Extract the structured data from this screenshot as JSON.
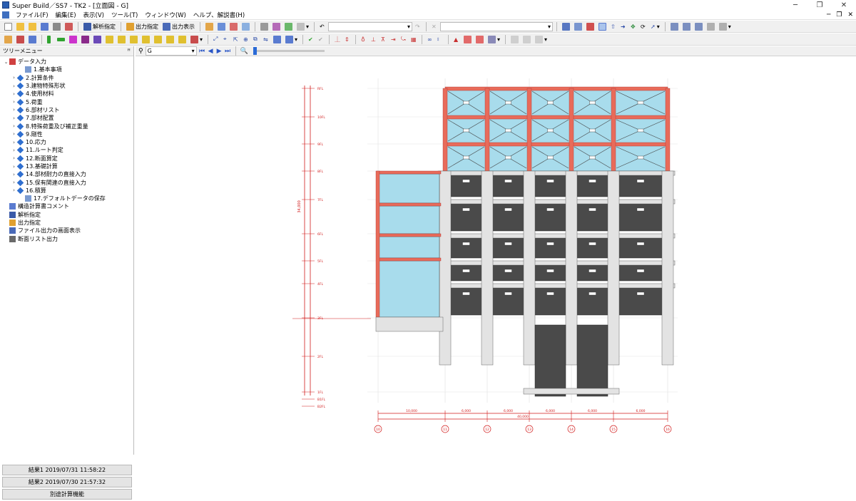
{
  "window": {
    "title": "Super Build／SS7 - TK2 - [立面図 - G]"
  },
  "menu": [
    "ファイル(F)",
    "編集(E)",
    "表示(V)",
    "ツール(T)",
    "ウィンドウ(W)",
    "ヘルプ、解説書(H)"
  ],
  "toolbar": {
    "analysis_label": "解析指定",
    "output_label": "出力指定",
    "display_label": "出力表示"
  },
  "nav": {
    "frame_value": "G"
  },
  "panel": {
    "title": "ツリーメニュー",
    "pin": "ꟸ"
  },
  "tree": [
    {
      "label": "データ入力",
      "depth": 0,
      "expanded": true,
      "icon": "data-input-icon"
    },
    {
      "label": "1.基本事項",
      "depth": 2,
      "expanded": null,
      "icon": "sheet-icon"
    },
    {
      "label": "2.計算条件",
      "depth": 1,
      "expanded": false,
      "icon": "diamond-icon"
    },
    {
      "label": "3.建物特殊形状",
      "depth": 1,
      "expanded": false,
      "icon": "diamond-icon"
    },
    {
      "label": "4.使用材料",
      "depth": 1,
      "expanded": false,
      "icon": "diamond-icon"
    },
    {
      "label": "5.荷重",
      "depth": 1,
      "expanded": false,
      "icon": "diamond-icon"
    },
    {
      "label": "6.部材リスト",
      "depth": 1,
      "expanded": false,
      "icon": "diamond-icon"
    },
    {
      "label": "7.部材配置",
      "depth": 1,
      "expanded": false,
      "icon": "diamond-icon"
    },
    {
      "label": "8.特殊荷重及び補正重量",
      "depth": 1,
      "expanded": false,
      "icon": "diamond-icon"
    },
    {
      "label": "9.剛性",
      "depth": 1,
      "expanded": false,
      "icon": "diamond-icon"
    },
    {
      "label": "10.応力",
      "depth": 1,
      "expanded": false,
      "icon": "diamond-icon"
    },
    {
      "label": "11.ルート判定",
      "depth": 1,
      "expanded": false,
      "icon": "diamond-icon"
    },
    {
      "label": "12.断面算定",
      "depth": 1,
      "expanded": false,
      "icon": "diamond-icon"
    },
    {
      "label": "13.基礎計算",
      "depth": 1,
      "expanded": false,
      "icon": "diamond-icon"
    },
    {
      "label": "14.部材耐力の直接入力",
      "depth": 1,
      "expanded": false,
      "icon": "diamond-icon"
    },
    {
      "label": "15.保有関連の直接入力",
      "depth": 1,
      "expanded": false,
      "icon": "diamond-icon"
    },
    {
      "label": "16.積算",
      "depth": 1,
      "expanded": false,
      "icon": "diamond-icon"
    },
    {
      "label": "17.デフォルトデータの保存",
      "depth": 2,
      "expanded": null,
      "icon": "sheet-icon"
    },
    {
      "label": "構造計算書コメント",
      "depth": 0,
      "expanded": null,
      "icon": "comment-icon"
    },
    {
      "label": "解析指定",
      "depth": 0,
      "expanded": null,
      "icon": "analysis-icon"
    },
    {
      "label": "出力指定",
      "depth": 0,
      "expanded": null,
      "icon": "output-icon"
    },
    {
      "label": "ファイル出力の画面表示",
      "depth": 0,
      "expanded": null,
      "icon": "file-output-icon"
    },
    {
      "label": "断面リスト出力",
      "depth": 0,
      "expanded": null,
      "icon": "section-list-icon"
    }
  ],
  "results": [
    {
      "label": "結果1 2019/07/31 11:58:22"
    },
    {
      "label": "結果2 2019/07/30 21:57:32"
    }
  ],
  "separate_calc_label": "別途計算機能",
  "elevation": {
    "grid_labels": [
      "10",
      "11",
      "12",
      "13",
      "14",
      "15",
      "16"
    ],
    "span_labels": [
      "10,000",
      "6,000",
      "6,000",
      "6,000",
      "6,000",
      "6,000"
    ],
    "total_span": "40,000",
    "story_labels": [
      "RFL",
      "10FL",
      "9FL",
      "8FL",
      "7FL",
      "6FL",
      "5FL",
      "4FL",
      "3FL",
      "2FL",
      "1FL",
      "B1FL",
      "B2FL"
    ],
    "overall_height": "34,000",
    "colors": {
      "dim": "#d11a1a",
      "steel": "#e86b5a",
      "glass": "#a8dcec",
      "concrete": "#e3e3e3",
      "dark": "#4a4a4a"
    }
  }
}
